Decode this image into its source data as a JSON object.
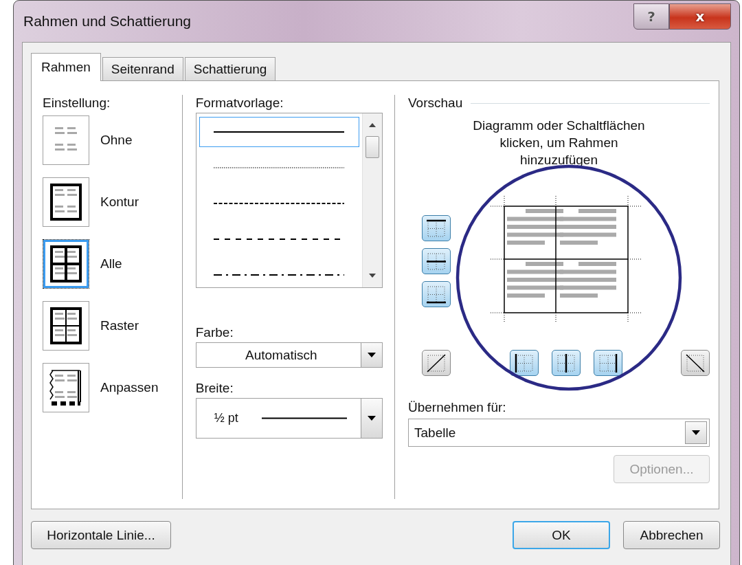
{
  "window": {
    "title": "Rahmen und Schattierung"
  },
  "title_buttons": [
    {
      "kind": "help",
      "label": "?"
    },
    {
      "kind": "close",
      "label": "x"
    }
  ],
  "tabs": [
    {
      "label": "Rahmen",
      "selected": true
    },
    {
      "label": "Seitenrand",
      "selected": false
    },
    {
      "label": "Schattierung",
      "selected": false
    }
  ],
  "setting": {
    "label": "Einstellung:",
    "options": [
      {
        "label": "Ohne",
        "kind": "none",
        "selected": false
      },
      {
        "label": "Kontur",
        "kind": "box",
        "selected": false
      },
      {
        "label": "Alle",
        "kind": "all",
        "selected": true
      },
      {
        "label": "Raster",
        "kind": "grid",
        "selected": false
      },
      {
        "label": "Anpassen",
        "kind": "custom",
        "selected": false
      }
    ]
  },
  "style": {
    "label": "Formatvorlage:",
    "line_styles": [
      {
        "kind": "solid",
        "selected": true
      },
      {
        "kind": "dotted",
        "selected": false
      },
      {
        "kind": "dashed",
        "selected": false
      },
      {
        "kind": "dashed_wide",
        "selected": false
      },
      {
        "kind": "dash_dot",
        "selected": false
      }
    ]
  },
  "color": {
    "label": "Farbe:",
    "value": "Automatisch"
  },
  "width": {
    "label": "Breite:",
    "value": "½ pt"
  },
  "preview": {
    "label": "Vorschau",
    "hint": "Diagramm oder Schaltflächen klicken, um Rahmen hinzuzufügen",
    "side_buttons": [
      {
        "kind": "top",
        "selected": true
      },
      {
        "kind": "middle_h",
        "selected": true
      },
      {
        "kind": "bottom",
        "selected": true
      }
    ],
    "bottom_buttons": [
      {
        "kind": "diag_up",
        "selected": false
      },
      {
        "kind": "left",
        "selected": true
      },
      {
        "kind": "middle_v",
        "selected": true
      },
      {
        "kind": "right",
        "selected": true
      },
      {
        "kind": "diag_down",
        "selected": false
      }
    ]
  },
  "apply": {
    "label": "Übernehmen für:",
    "value": "Tabelle"
  },
  "options_button": {
    "label": "Optionen...",
    "disabled": true
  },
  "buttons": [
    {
      "label": "Horizontale Linie...",
      "default": false
    },
    {
      "label": "OK",
      "default": true
    },
    {
      "label": "Abbrechen",
      "default": false
    }
  ],
  "annotations": [
    {
      "kind": "circle"
    }
  ]
}
